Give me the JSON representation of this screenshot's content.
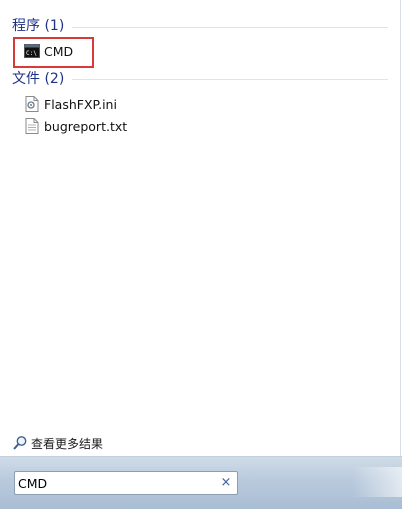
{
  "groups": {
    "programs": {
      "header": "程序 (1)",
      "items": [
        {
          "label": "CMD",
          "icon": "cmd-icon"
        }
      ]
    },
    "files": {
      "header": "文件 (2)",
      "items": [
        {
          "label": "FlashFXP.ini",
          "icon": "ini-file-icon"
        },
        {
          "label": "bugreport.txt",
          "icon": "txt-file-icon"
        }
      ]
    }
  },
  "see_more": {
    "label": "查看更多结果",
    "icon": "search-icon"
  },
  "search": {
    "value": "CMD",
    "clear_icon": "close-icon",
    "clear_label": "×"
  },
  "colors": {
    "header": "#1e3287",
    "highlight": "#d83a3a"
  }
}
